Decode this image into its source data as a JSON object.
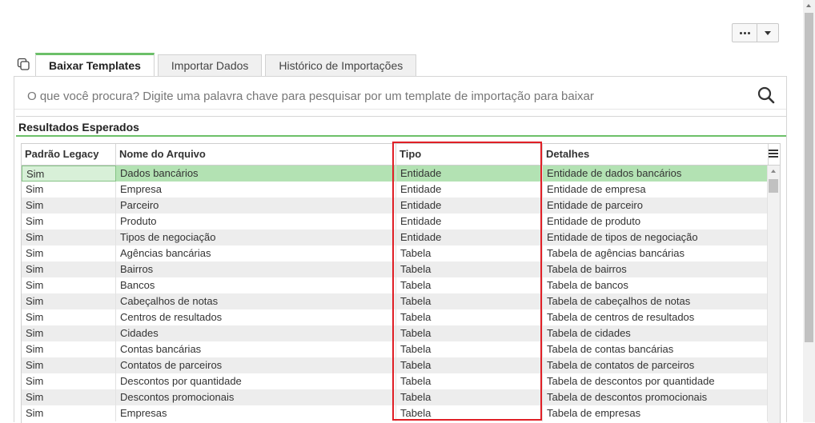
{
  "toolbar": {
    "more_icon": "ellipsis-icon",
    "caret_icon": "chevron-down-icon"
  },
  "tabs": [
    {
      "label": "Baixar Templates",
      "active": true
    },
    {
      "label": "Importar Dados",
      "active": false
    },
    {
      "label": "Histórico de Importações",
      "active": false
    }
  ],
  "search": {
    "placeholder": "O que você procura? Digite uma palavra chave para pesquisar por um template de importação para baixar",
    "icon": "search-icon"
  },
  "results_title": "Resultados Esperados",
  "grid": {
    "columns": [
      "Padrão Legacy",
      "Nome do Arquivo",
      "Tipo",
      "Detalhes"
    ],
    "rows": [
      [
        "Sim",
        "Dados bancários",
        "Entidade",
        "Entidade de dados bancários"
      ],
      [
        "Sim",
        "Empresa",
        "Entidade",
        "Entidade de empresa"
      ],
      [
        "Sim",
        "Parceiro",
        "Entidade",
        "Entidade de parceiro"
      ],
      [
        "Sim",
        "Produto",
        "Entidade",
        "Entidade de produto"
      ],
      [
        "Sim",
        "Tipos de negociação",
        "Entidade",
        "Entidade de tipos de negociação"
      ],
      [
        "Sim",
        "Agências bancárias",
        "Tabela",
        "Tabela de agências bancárias"
      ],
      [
        "Sim",
        "Bairros",
        "Tabela",
        "Tabela de bairros"
      ],
      [
        "Sim",
        "Bancos",
        "Tabela",
        "Tabela de bancos"
      ],
      [
        "Sim",
        "Cabeçalhos de notas",
        "Tabela",
        "Tabela de cabeçalhos de notas"
      ],
      [
        "Sim",
        "Centros de resultados",
        "Tabela",
        "Tabela de centros de resultados"
      ],
      [
        "Sim",
        "Cidades",
        "Tabela",
        "Tabela de cidades"
      ],
      [
        "Sim",
        "Contas bancárias",
        "Tabela",
        "Tabela de contas bancárias"
      ],
      [
        "Sim",
        "Contatos de parceiros",
        "Tabela",
        "Tabela de contatos de parceiros"
      ],
      [
        "Sim",
        "Descontos por quantidade",
        "Tabela",
        "Tabela de descontos por quantidade"
      ],
      [
        "Sim",
        "Descontos promocionais",
        "Tabela",
        "Tabela de descontos promocionais"
      ],
      [
        "Sim",
        "Empresas",
        "Tabela",
        "Tabela de empresas"
      ]
    ],
    "selected_row": 0
  },
  "colors": {
    "accent": "#6cc069",
    "selected_row": "#b3e2b3",
    "highlight": "#e01f26"
  }
}
